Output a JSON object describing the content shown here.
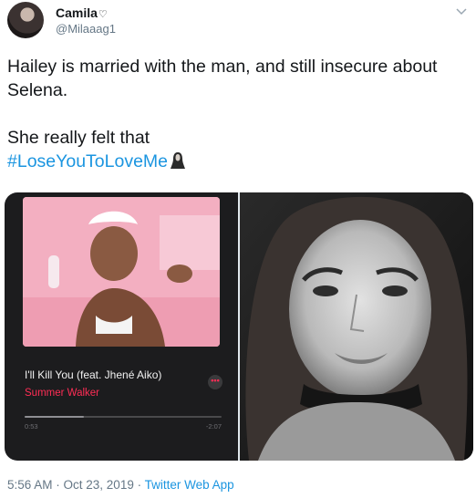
{
  "tweet": {
    "display_name": "Camila",
    "heart_glyph": "♡",
    "handle": "@Milaaag1",
    "line1": "Hailey is married with the man, and still insecure about Selena.",
    "line2": "She really felt that",
    "hashtag": "#LoseYouToLoveMe",
    "emoji": "woman-with-long-hair-silhouette-icon",
    "timestamp": "5:56 AM · Oct 23, 2019 · ",
    "source": "Twitter Web App"
  },
  "media": {
    "left": {
      "song_title": "I'll Kill You (feat. Jhené Aiko)",
      "artist": "Summer Walker",
      "more_glyph": "•••",
      "time_elapsed": "0:53",
      "time_remaining": "-2:07",
      "progress": 0.3
    },
    "right": {
      "description_icon": "black-and-white-portrait-photo"
    }
  },
  "colors": {
    "text": "#14171a",
    "secondary": "#657786",
    "link": "#1b95e0",
    "accent_red": "#ff2d55"
  }
}
